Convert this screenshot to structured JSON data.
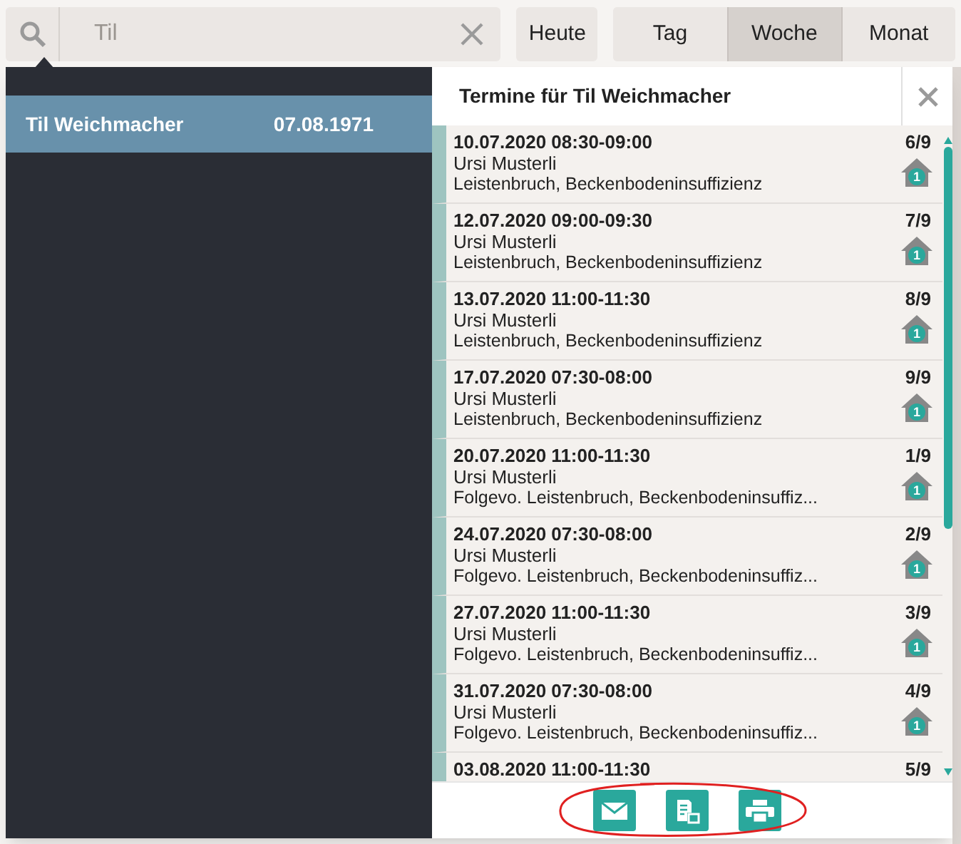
{
  "search": {
    "value": "Til"
  },
  "toolbar": {
    "today_button": "Heute",
    "view_tabs": [
      {
        "label": "Tag",
        "selected": false
      },
      {
        "label": "Woche",
        "selected": true
      },
      {
        "label": "Monat",
        "selected": false
      }
    ]
  },
  "results": [
    {
      "name": "Til Weichmacher",
      "birthdate": "07.08.1971",
      "selected": true
    }
  ],
  "appointments_panel": {
    "title": "Termine für Til Weichmacher",
    "appointments": [
      {
        "datetime": "10.07.2020 08:30-09:00",
        "therapist": "Ursi Musterli",
        "diagnosis": "Leistenbruch, Beckenbodeninsuffizienz",
        "count": "6/9",
        "badge": "1"
      },
      {
        "datetime": "12.07.2020 09:00-09:30",
        "therapist": "Ursi Musterli",
        "diagnosis": "Leistenbruch, Beckenbodeninsuffizienz",
        "count": "7/9",
        "badge": "1"
      },
      {
        "datetime": "13.07.2020 11:00-11:30",
        "therapist": "Ursi Musterli",
        "diagnosis": "Leistenbruch, Beckenbodeninsuffizienz",
        "count": "8/9",
        "badge": "1"
      },
      {
        "datetime": "17.07.2020 07:30-08:00",
        "therapist": "Ursi Musterli",
        "diagnosis": "Leistenbruch, Beckenbodeninsuffizienz",
        "count": "9/9",
        "badge": "1"
      },
      {
        "datetime": "20.07.2020 11:00-11:30",
        "therapist": "Ursi Musterli",
        "diagnosis": "Folgevo. Leistenbruch, Beckenbodeninsuffiz...",
        "count": "1/9",
        "badge": "1"
      },
      {
        "datetime": "24.07.2020 07:30-08:00",
        "therapist": "Ursi Musterli",
        "diagnosis": "Folgevo. Leistenbruch, Beckenbodeninsuffiz...",
        "count": "2/9",
        "badge": "1"
      },
      {
        "datetime": "27.07.2020 11:00-11:30",
        "therapist": "Ursi Musterli",
        "diagnosis": "Folgevo. Leistenbruch, Beckenbodeninsuffiz...",
        "count": "3/9",
        "badge": "1"
      },
      {
        "datetime": "31.07.2020 07:30-08:00",
        "therapist": "Ursi Musterli",
        "diagnosis": "Folgevo. Leistenbruch, Beckenbodeninsuffiz...",
        "count": "4/9",
        "badge": "1"
      },
      {
        "datetime": "03.08.2020 11:00-11:30",
        "count": "5/9"
      }
    ]
  }
}
